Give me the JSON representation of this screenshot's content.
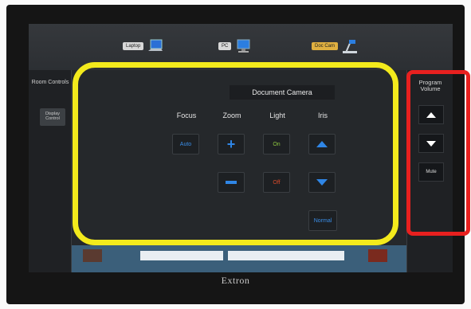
{
  "sources": [
    {
      "label": "Laptop",
      "icon": "laptop-icon",
      "active": false
    },
    {
      "label": "PC",
      "icon": "pc-icon",
      "active": false
    },
    {
      "label": "Doc Cam",
      "icon": "doc-cam-icon",
      "active": true
    }
  ],
  "left_panel": {
    "room_controls": "Room Controls",
    "display_control": "Display Control"
  },
  "camera": {
    "title": "Document Camera",
    "columns": {
      "focus": "Focus",
      "zoom": "Zoom",
      "light": "Light",
      "iris": "Iris"
    },
    "focus_auto": "Auto",
    "light_on": "On",
    "light_off": "Off",
    "iris_normal": "Normal"
  },
  "volume": {
    "label": "Program Volume",
    "mute": "Mute"
  },
  "brand": "Extron",
  "colors": {
    "highlight_yellow": "#f3ea1c",
    "highlight_red": "#e8201f",
    "accent_blue": "#2f86e6",
    "light_on": "#8dc63f",
    "light_off": "#d84a2a"
  }
}
